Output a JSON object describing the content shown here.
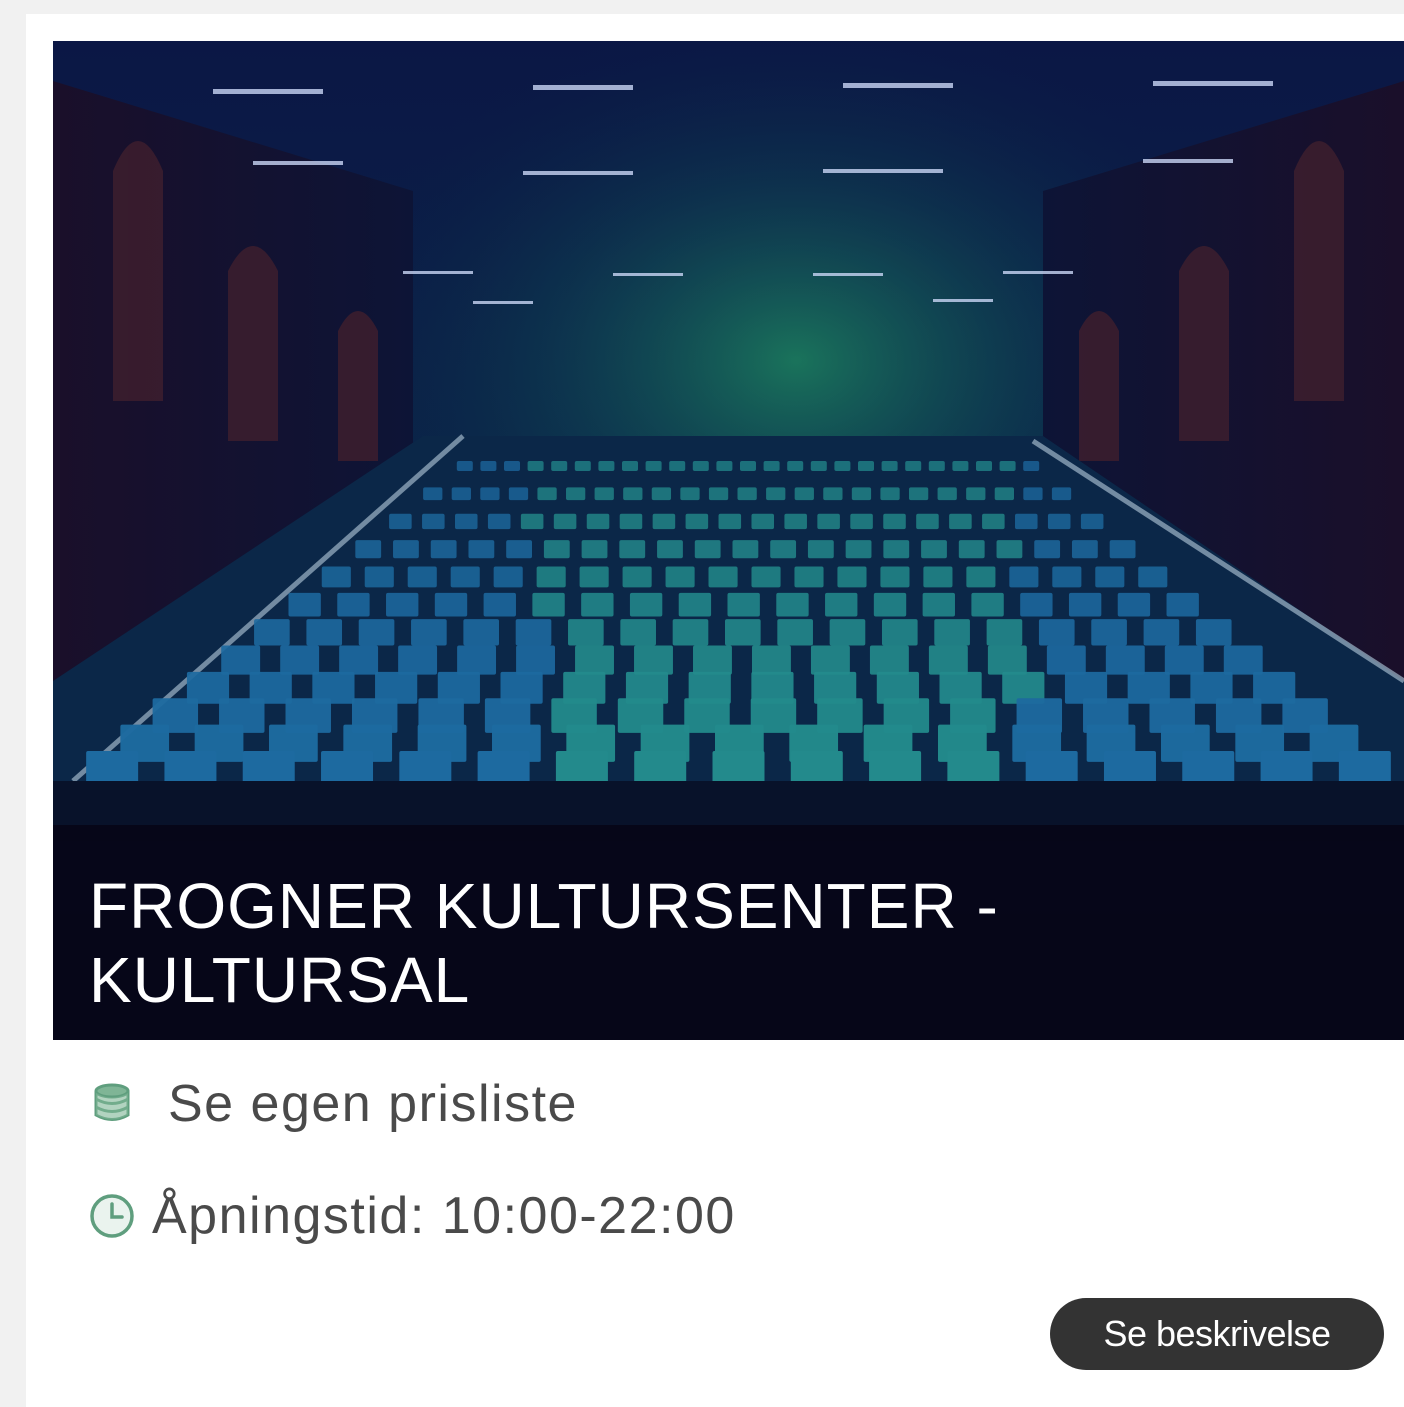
{
  "venue": {
    "title_line1": "FROGNER KULTURSENTER -",
    "title_line2": "KULTURSAL",
    "image_icon": "auditorium-photo"
  },
  "details": {
    "price_icon": "coins-stack-icon",
    "price_text": "Se egen prisliste",
    "hours_icon": "clock-icon",
    "hours_text": "Åpningstid: 10:00-22:00"
  },
  "actions": {
    "description_button_label": "Se beskrivelse"
  },
  "colors": {
    "icon_accent": "#5f9e7e",
    "button_bg": "#333333",
    "text_muted": "#4a4a4a",
    "title_band": "#060618"
  }
}
